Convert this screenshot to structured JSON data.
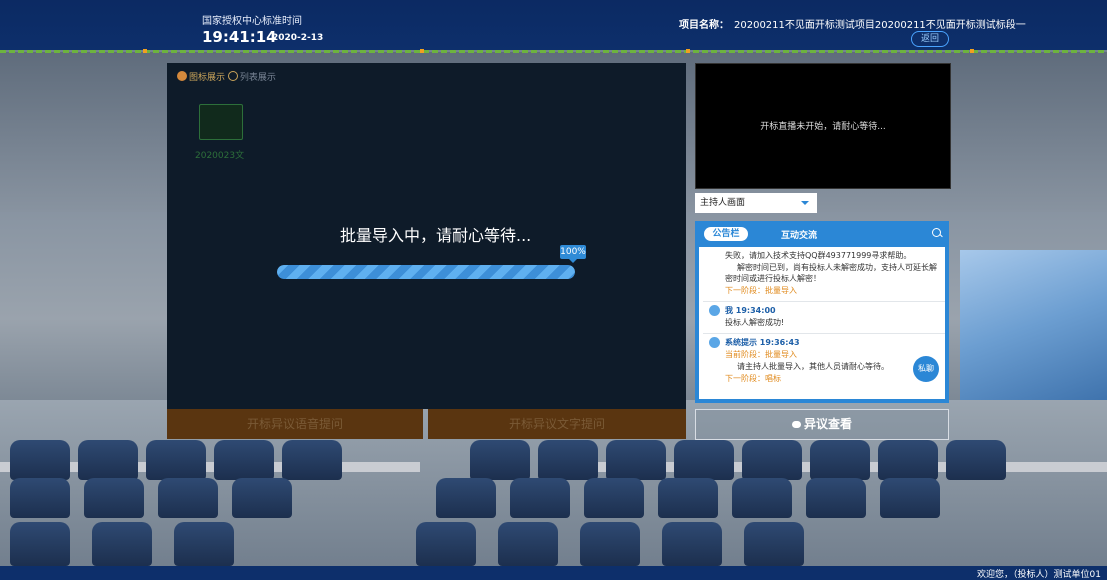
{
  "header": {
    "time_label": "国家授权中心标准时间",
    "clock": "19:41:14",
    "date": "2020-2-13",
    "project_label": "项目名称：",
    "project_name": "20200211不见面开标测试项目20200211不见面开标测试标段一",
    "back_label": "返回"
  },
  "main": {
    "view_options": [
      "图标展示",
      "列表展示"
    ],
    "folder_label": "2020023文",
    "loading_text": "批量导入中，请耐心等待...",
    "progress": 100,
    "progress_label": "100%",
    "voice_button": "开标异议语音提问",
    "text_button": "开标异议文字提问"
  },
  "video": {
    "message": "开标直播未开始，请耐心等待..."
  },
  "selector": {
    "value": "主持人画面"
  },
  "chat": {
    "tabs": [
      "公告栏",
      "互动交流"
    ],
    "messages": [
      {
        "lines": [
          "失败，请加入技术支持QQ群493771999寻求帮助。",
          "解密时间已到，尚有投标人未解密成功，支持人可延长解密时间或进行投标人解密！"
        ],
        "stage": "下一阶段：批量导入"
      },
      {
        "who": "我 19:34:00",
        "lines": [
          "投标人解密成功!"
        ]
      },
      {
        "who": "系统提示 19:36:43",
        "current_stage": "当前阶段：批量导入",
        "lines": [
          "请主持人批量导入，其他人员请耐心等待。"
        ],
        "stage": "下一阶段：唱标"
      }
    ],
    "private_label": "私聊"
  },
  "objection_button": "异议查看",
  "footer": {
    "welcome": "欢迎您，（投标人）测试单位01"
  },
  "colors": {
    "header": "#0d2f6b",
    "accent": "#2b87d6",
    "stage": "#e08a1c",
    "button_brown": "#5a3510"
  }
}
